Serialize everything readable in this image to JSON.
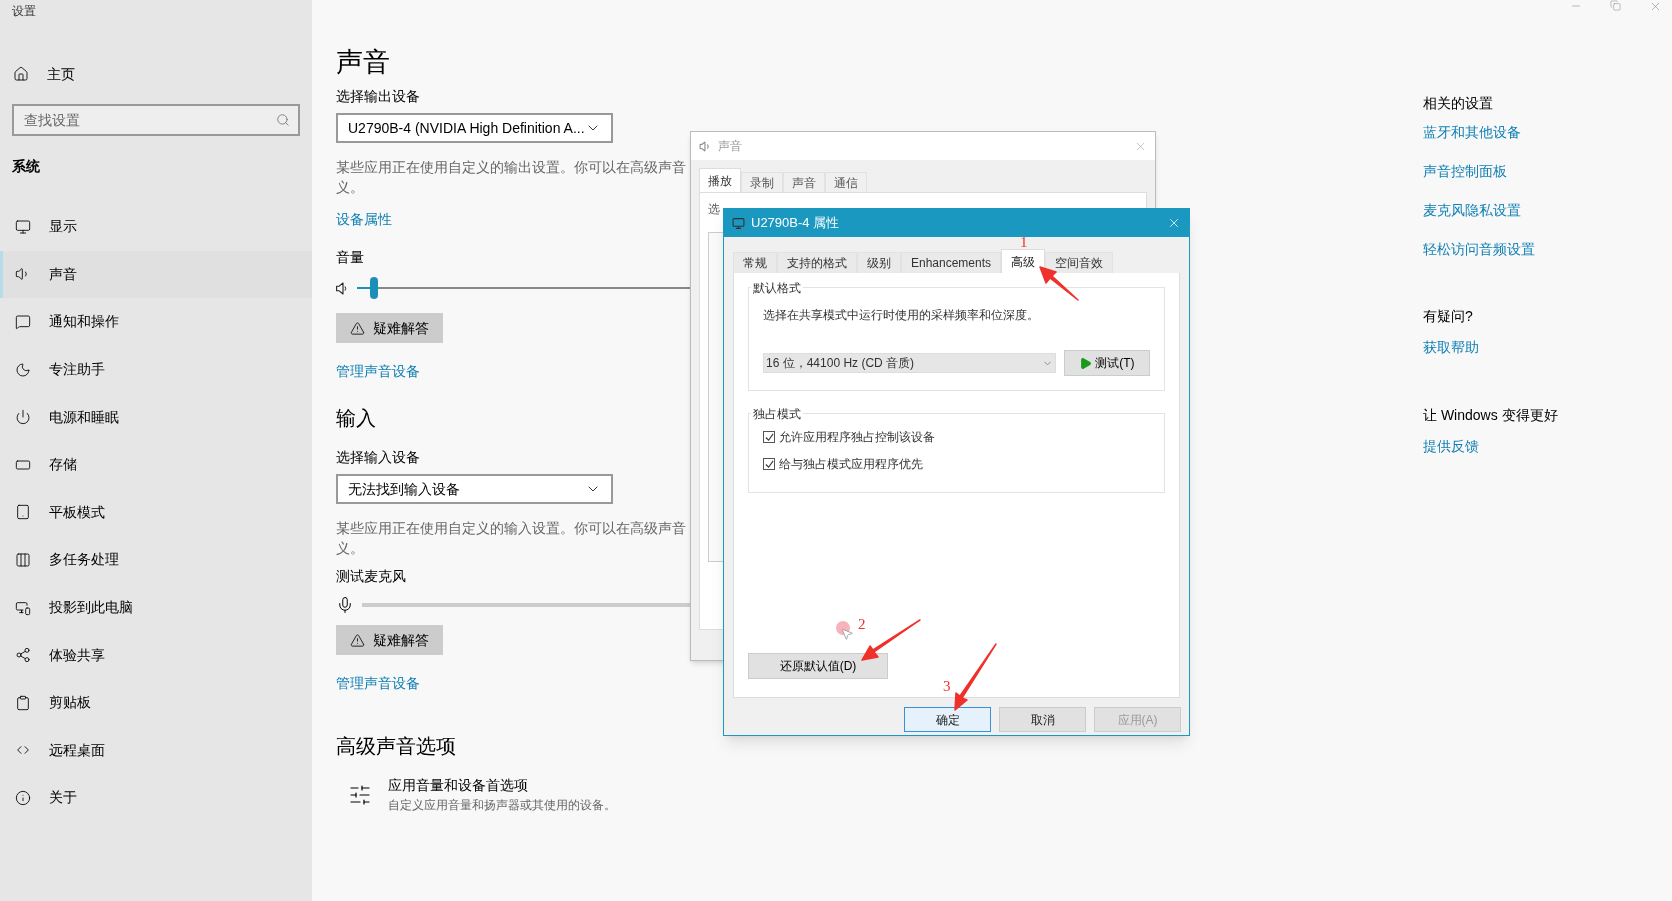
{
  "window": {
    "title": "设置"
  },
  "sidebar": {
    "home": "主页",
    "search": {
      "placeholder": "查找设置"
    },
    "section": "系统",
    "items": [
      {
        "label": "显示",
        "selected": false
      },
      {
        "label": "声音",
        "selected": true
      },
      {
        "label": "通知和操作",
        "selected": false
      },
      {
        "label": "专注助手",
        "selected": false
      },
      {
        "label": "电源和睡眠",
        "selected": false
      },
      {
        "label": "存储",
        "selected": false
      },
      {
        "label": "平板模式",
        "selected": false
      },
      {
        "label": "多任务处理",
        "selected": false
      },
      {
        "label": "投影到此电脑",
        "selected": false
      },
      {
        "label": "体验共享",
        "selected": false
      },
      {
        "label": "剪贴板",
        "selected": false
      },
      {
        "label": "远程桌面",
        "selected": false
      },
      {
        "label": "关于",
        "selected": false
      }
    ]
  },
  "main": {
    "title": "声音",
    "output": {
      "label": "选择输出设备",
      "device": "U2790B-4 (NVIDIA High Definition A...",
      "note": "某些应用正在使用自定义的输出设置。你可以在高级声音义。",
      "link": "设备属性",
      "volume": {
        "label": "音量",
        "level": 0.03
      },
      "troubleshoot": "疑难解答",
      "manage": "管理声音设备"
    },
    "input": {
      "heading": "输入",
      "label": "选择输入设备",
      "device": "无法找到输入设备",
      "note": "某些应用正在使用自定义的输入设置。你可以在高级声音义。",
      "mic_label": "测试麦克风",
      "troubleshoot": "疑难解答",
      "manage": "管理声音设备"
    },
    "advanced": {
      "heading": "高级声音选项",
      "item_title": "应用音量和设备首选项",
      "item_description": "自定义应用音量和扬声器或其使用的设备。"
    }
  },
  "related": {
    "heading": "相关的设置",
    "links": [
      "蓝牙和其他设备",
      "声音控制面板",
      "麦克风隐私设置",
      "轻松访问音频设置"
    ],
    "help_heading": "有疑问?",
    "help_link": "获取帮助",
    "feedback_heading": "让 Windows 变得更好",
    "feedback_link": "提供反馈"
  },
  "sound_dialog": {
    "title": "声音",
    "tabs": [
      {
        "label": "播放",
        "selected": true
      },
      {
        "label": "录制",
        "selected": false
      },
      {
        "label": "声音",
        "selected": false
      },
      {
        "label": "通信",
        "selected": false
      }
    ],
    "list_heading": "选"
  },
  "properties_dialog": {
    "title": "U2790B-4 属性",
    "tabs": [
      {
        "label": "常规",
        "selected": false
      },
      {
        "label": "支持的格式",
        "selected": false
      },
      {
        "label": "级别",
        "selected": false
      },
      {
        "label": "Enhancements",
        "selected": false
      },
      {
        "label": "高级",
        "selected": true
      },
      {
        "label": "空间音效",
        "selected": false
      }
    ],
    "default_format": {
      "legend": "默认格式",
      "description": "选择在共享模式中运行时使用的采样频率和位深度。",
      "format": "16 位，44100 Hz (CD 音质)",
      "test_button": "测试(T)"
    },
    "exclusive_mode": {
      "legend": "独占模式",
      "options": [
        {
          "label": "允许应用程序独占控制该设备",
          "checked": true
        },
        {
          "label": "给与独占模式应用程序优先",
          "checked": true
        }
      ]
    },
    "restore_button": "还原默认值(D)",
    "buttons": [
      {
        "label": "确定",
        "focused": true,
        "disabled": false
      },
      {
        "label": "取消",
        "focused": false,
        "disabled": false
      },
      {
        "label": "应用(A)",
        "focused": false,
        "disabled": true
      }
    ]
  },
  "annotations": [
    {
      "label": "1"
    },
    {
      "label": "2"
    },
    {
      "label": "3"
    }
  ]
}
